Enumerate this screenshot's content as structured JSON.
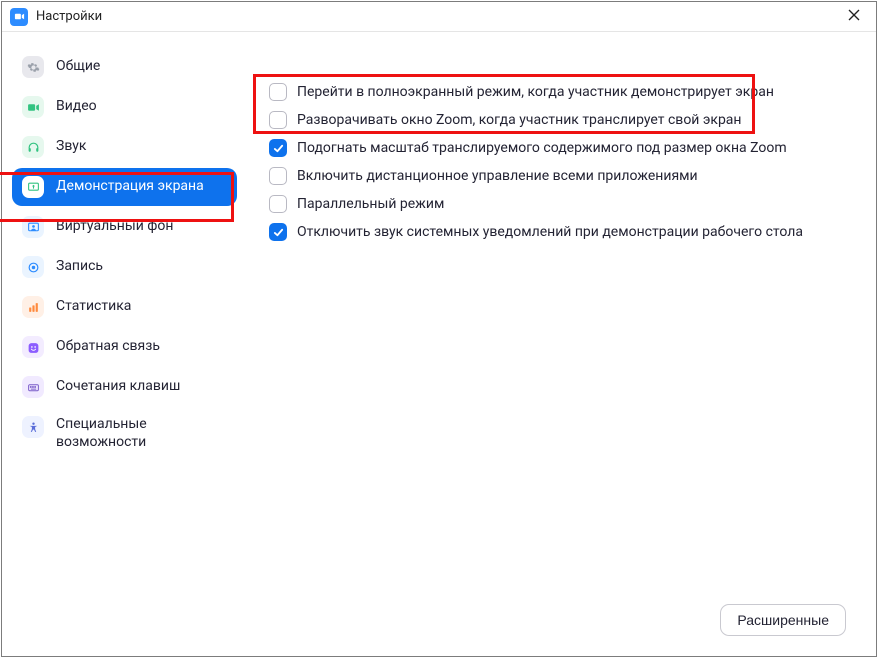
{
  "window": {
    "title": "Настройки"
  },
  "sidebar": {
    "items": [
      {
        "id": "general",
        "label": "Общие"
      },
      {
        "id": "video",
        "label": "Видео"
      },
      {
        "id": "audio",
        "label": "Звук"
      },
      {
        "id": "share",
        "label": "Демонстрация экрана",
        "selected": true
      },
      {
        "id": "vbg",
        "label": "Виртуальный фон"
      },
      {
        "id": "record",
        "label": "Запись"
      },
      {
        "id": "stats",
        "label": "Статистика"
      },
      {
        "id": "feedback",
        "label": "Обратная связь"
      },
      {
        "id": "keyboard",
        "label": "Сочетания клавиш"
      },
      {
        "id": "access",
        "label": "Специальные возможности"
      }
    ]
  },
  "options": [
    {
      "checked": false,
      "label": "Перейти в полноэкранный режим, когда участник демонстрирует экран"
    },
    {
      "checked": false,
      "label": "Разворачивать окно Zoom, когда участник транслирует свой экран"
    },
    {
      "checked": true,
      "label": "Подогнать масштаб транслируемого содержимого под размер окна Zoom"
    },
    {
      "checked": false,
      "label": "Включить дистанционное управление всеми приложениями"
    },
    {
      "checked": false,
      "label": "Параллельный режим"
    },
    {
      "checked": true,
      "label": "Отключить звук системных уведомлений при демонстрации рабочего стола"
    }
  ],
  "footer": {
    "advanced_label": "Расширенные"
  },
  "highlights": {
    "sidebar_box": true,
    "options_box": true
  },
  "colors": {
    "accent": "#0e72ed",
    "highlight": "#e11"
  }
}
